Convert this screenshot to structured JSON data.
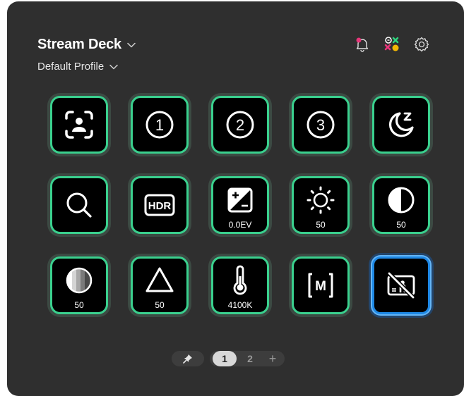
{
  "app": {
    "title": "Stream Deck",
    "profile": "Default Profile"
  },
  "toolbar": {
    "icons": [
      "notification-bell-icon",
      "marketplace-icon",
      "settings-gear-icon"
    ]
  },
  "keys": [
    {
      "name": "center-stage-icon",
      "value": ""
    },
    {
      "name": "preset-1-icon",
      "value": ""
    },
    {
      "name": "preset-2-icon",
      "value": ""
    },
    {
      "name": "preset-3-icon",
      "value": ""
    },
    {
      "name": "sleep-moon-icon",
      "value": ""
    },
    {
      "name": "zoom-magnifier-icon",
      "value": ""
    },
    {
      "name": "hdr-icon",
      "value": ""
    },
    {
      "name": "exposure-icon",
      "value": "0.0EV"
    },
    {
      "name": "brightness-sun-icon",
      "value": "50"
    },
    {
      "name": "contrast-icon",
      "value": "50"
    },
    {
      "name": "saturation-icon",
      "value": "50"
    },
    {
      "name": "sharpness-triangle-icon",
      "value": "50"
    },
    {
      "name": "white-balance-thermometer-icon",
      "value": "4100K"
    },
    {
      "name": "manual-focus-icon",
      "value": ""
    },
    {
      "name": "backlight-off-icon",
      "value": ""
    }
  ],
  "pager": {
    "pages": [
      "1",
      "2"
    ],
    "active": "1",
    "add_label": "+"
  },
  "colors": {
    "window_bg": "#2f2f2f",
    "key_border": "#3ad08e",
    "selected_border": "#1e88e5",
    "notify_accent": "#e8367a"
  }
}
